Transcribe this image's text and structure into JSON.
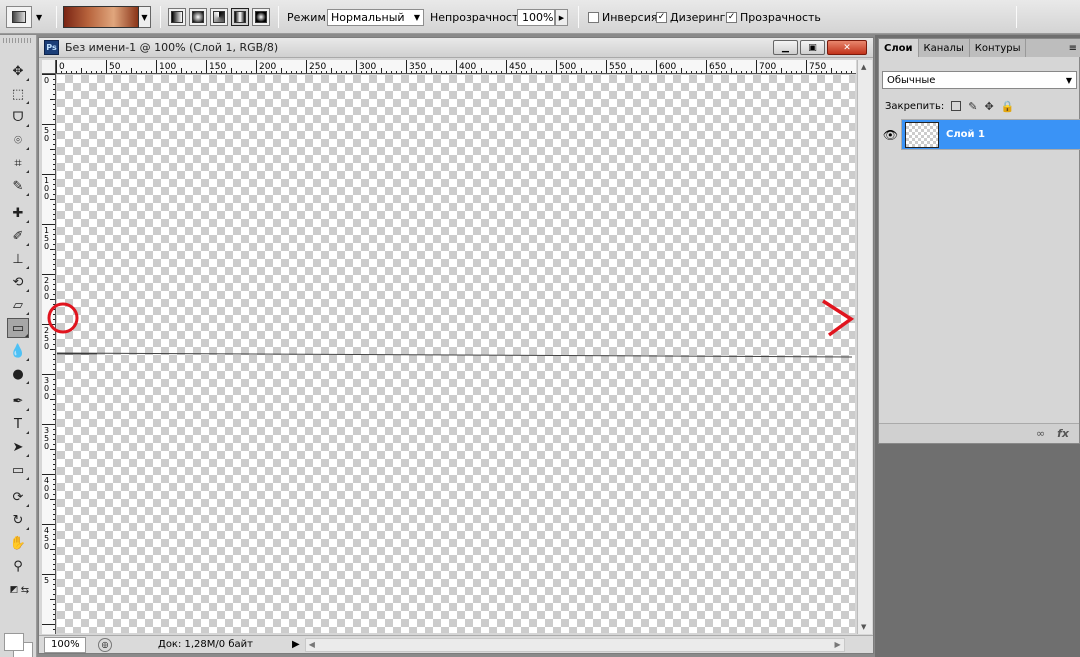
{
  "options": {
    "mode_label": "Режим:",
    "mode_value": "Нормальный",
    "opacity_label": "Непрозрачность:",
    "opacity_value": "100%",
    "inverse_label": "Инверсия",
    "inverse_checked": false,
    "dither_label": "Дизеринг",
    "dither_checked": true,
    "transparency_label": "Прозрачность",
    "transparency_checked": true,
    "gradient_colors": [
      "#7a2514",
      "#b8643d",
      "#e0a67d",
      "#8a3418"
    ],
    "gradient_types": [
      "linear",
      "radial",
      "angle",
      "reflected",
      "diamond"
    ],
    "active_gradient_type": "reflected"
  },
  "toolbox": {
    "tools": [
      "move",
      "marquee",
      "lasso",
      "quick-selection",
      "crop",
      "eyedropper",
      "healing-brush",
      "brush",
      "clone-stamp",
      "history-brush",
      "eraser",
      "gradient",
      "blur",
      "dodge",
      "pen",
      "type",
      "path-selection",
      "rectangle",
      "3d-rotate",
      "3d-orbit",
      "hand",
      "zoom"
    ],
    "active_tool": "gradient",
    "foreground_color": "#ffffff",
    "background_color": "#ffffff"
  },
  "document": {
    "icon_text": "Ps",
    "title": "Без имени-1 @ 100% (Слой 1, RGB/8)",
    "ruler_h_labels": [
      "0",
      "50",
      "100",
      "150",
      "200",
      "250",
      "300",
      "350",
      "400",
      "450",
      "500",
      "550",
      "600",
      "650",
      "700",
      "750"
    ],
    "ruler_v_labels": [
      "0",
      "5\n0",
      "1\n0\n0",
      "1\n5\n0",
      "2\n0\n0",
      "2\n5\n0",
      "3\n0\n0",
      "3\n5\n0",
      "4\n0\n0",
      "4\n5\n0",
      "5"
    ],
    "status": {
      "zoom": "100%",
      "doc_info": "Док: 1,28M/0 байт"
    }
  },
  "annotation": {
    "color": "#e0141e"
  },
  "layers_panel": {
    "tabs": [
      "Слои",
      "Каналы",
      "Контуры"
    ],
    "active_tab": "Слои",
    "blend_mode": "Обычные",
    "lock_label": "Закрепить:",
    "layers": [
      {
        "name": "Слой 1",
        "visible": true,
        "selected": true
      }
    ],
    "footer_link": "∞",
    "footer_fx": "fx"
  }
}
